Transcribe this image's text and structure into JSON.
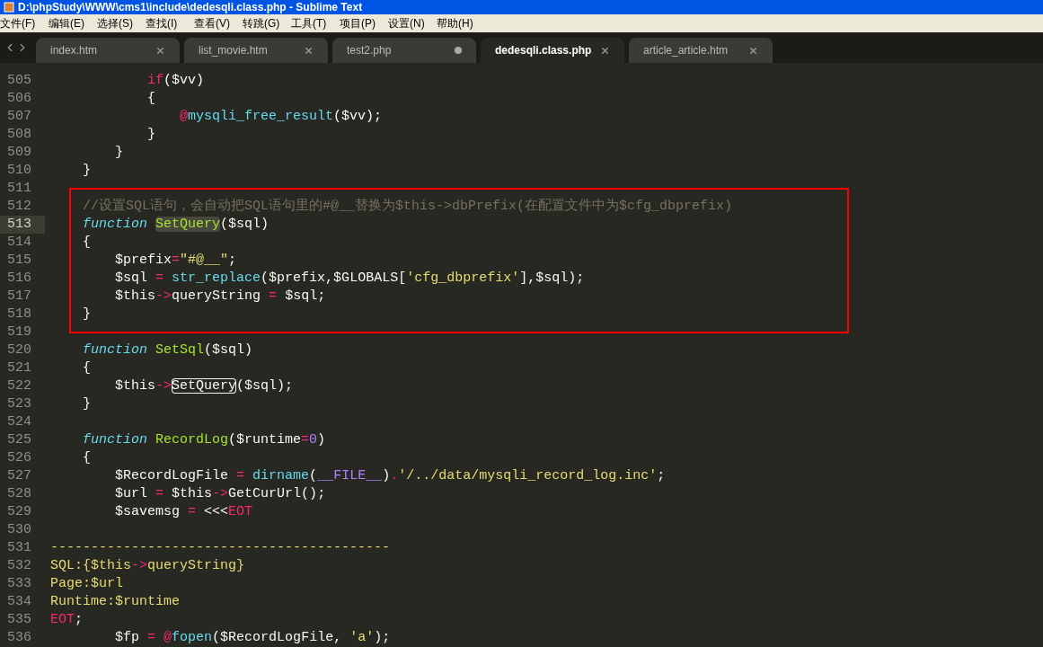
{
  "window": {
    "title": "D:\\phpStudy\\WWW\\cms1\\include\\dedesqli.class.php - Sublime Text"
  },
  "menu": [
    "文件(F)",
    "编辑(E)",
    "选择(S)",
    "查找(I)",
    "查看(V)",
    "转跳(G)",
    "工具(T)",
    "项目(P)",
    "设置(N)",
    "帮助(H)"
  ],
  "tabs": [
    {
      "label": "index.htm",
      "selected": false,
      "modified": false
    },
    {
      "label": "list_movie.htm",
      "selected": false,
      "modified": false
    },
    {
      "label": "test2.php",
      "selected": false,
      "modified": true
    },
    {
      "label": "dedesqli.class.php",
      "selected": true,
      "modified": false
    },
    {
      "label": "article_article.htm",
      "selected": false,
      "modified": false
    }
  ],
  "editor": {
    "lines": [
      {
        "number": "505",
        "current": false,
        "boxed": false,
        "tokens": [
          {
            "text": "            if",
            "kind": "keyword"
          },
          {
            "text": "($vv)",
            "kind": "plain"
          }
        ]
      },
      {
        "number": "506",
        "current": false,
        "boxed": false,
        "tokens": [
          {
            "text": "            {",
            "kind": "plain"
          }
        ]
      },
      {
        "number": "507",
        "current": false,
        "boxed": false,
        "tokens": [
          {
            "text": "                @",
            "kind": "keyword"
          },
          {
            "text": "mysqli_free_result",
            "kind": "builtin"
          },
          {
            "text": "($vv);",
            "kind": "plain"
          }
        ]
      },
      {
        "number": "508",
        "current": false,
        "boxed": false,
        "tokens": [
          {
            "text": "            }",
            "kind": "plain"
          }
        ]
      },
      {
        "number": "509",
        "current": false,
        "boxed": false,
        "tokens": [
          {
            "text": "        }",
            "kind": "plain"
          }
        ]
      },
      {
        "number": "510",
        "current": false,
        "boxed": false,
        "tokens": [
          {
            "text": "    }",
            "kind": "plain"
          }
        ]
      },
      {
        "number": "511",
        "current": false,
        "boxed": false
      },
      {
        "number": "512",
        "current": false,
        "boxed": true,
        "tokens": [
          {
            "text": "    //设置SQL语句，会自动把SQL语句里的#@__替换为$this->dbPrefix(在配置文件中为$cfg_dbprefix)",
            "kind": "comment"
          }
        ]
      },
      {
        "number": "513",
        "current": true,
        "boxed": true,
        "tokens": [
          {
            "text": "    function",
            "kind": "storage"
          },
          {
            "text": " SetQuery",
            "kind": "entity",
            "highlighted": true
          },
          {
            "text": "($sql)",
            "kind": "plain"
          }
        ]
      },
      {
        "number": "514",
        "current": false,
        "boxed": true,
        "tokens": [
          {
            "text": "    {",
            "kind": "plain"
          }
        ]
      },
      {
        "number": "515",
        "current": false,
        "boxed": true,
        "tokens": [
          {
            "text": "        $prefix",
            "kind": "plain"
          },
          {
            "text": "=",
            "kind": "keyword"
          },
          {
            "text": "\"#@__\"",
            "kind": "string"
          },
          {
            "text": ";",
            "kind": "plain"
          }
        ]
      },
      {
        "number": "516",
        "current": false,
        "boxed": true,
        "tokens": [
          {
            "text": "        $sql",
            "kind": "plain"
          },
          {
            "text": " =",
            "kind": "keyword"
          },
          {
            "text": " str_replace",
            "kind": "builtin"
          },
          {
            "text": "($prefix,$GLOBALS[",
            "kind": "plain"
          },
          {
            "text": "'cfg_dbprefix'",
            "kind": "string"
          },
          {
            "text": "],$sql);",
            "kind": "plain"
          }
        ]
      },
      {
        "number": "517",
        "current": false,
        "boxed": true,
        "tokens": [
          {
            "text": "        $this",
            "kind": "plain"
          },
          {
            "text": "->",
            "kind": "keyword"
          },
          {
            "text": "queryString",
            "kind": "plain"
          },
          {
            "text": " =",
            "kind": "keyword"
          },
          {
            "text": " $sql;",
            "kind": "plain"
          }
        ]
      },
      {
        "number": "518",
        "current": false,
        "boxed": true,
        "tokens": [
          {
            "text": "    }",
            "kind": "plain"
          }
        ]
      },
      {
        "number": "519",
        "current": false,
        "boxed": false
      },
      {
        "number": "520",
        "current": false,
        "boxed": false,
        "tokens": [
          {
            "text": "    function",
            "kind": "storage"
          },
          {
            "text": " SetSql",
            "kind": "entity"
          },
          {
            "text": "($sql)",
            "kind": "plain"
          }
        ]
      },
      {
        "number": "521",
        "current": false,
        "boxed": false,
        "tokens": [
          {
            "text": "    {",
            "kind": "plain"
          }
        ]
      },
      {
        "number": "522",
        "current": false,
        "boxed": false,
        "tokens": [
          {
            "text": "        $this",
            "kind": "plain"
          },
          {
            "text": "->",
            "kind": "keyword"
          },
          {
            "text": "SetQuery",
            "kind": "plain",
            "outlined": true
          },
          {
            "text": "($sql);",
            "kind": "plain"
          }
        ]
      },
      {
        "number": "523",
        "current": false,
        "boxed": false,
        "tokens": [
          {
            "text": "    }",
            "kind": "plain"
          }
        ]
      },
      {
        "number": "524",
        "current": false,
        "boxed": false
      },
      {
        "number": "525",
        "current": false,
        "boxed": false,
        "tokens": [
          {
            "text": "    function",
            "kind": "storage"
          },
          {
            "text": " RecordLog",
            "kind": "entity"
          },
          {
            "text": "($runtime",
            "kind": "plain"
          },
          {
            "text": "=",
            "kind": "keyword"
          },
          {
            "text": "0",
            "kind": "constant"
          },
          {
            "text": ")",
            "kind": "plain"
          }
        ]
      },
      {
        "number": "526",
        "current": false,
        "boxed": false,
        "tokens": [
          {
            "text": "    {",
            "kind": "plain"
          }
        ]
      },
      {
        "number": "527",
        "current": false,
        "boxed": false,
        "tokens": [
          {
            "text": "        $RecordLogFile",
            "kind": "plain"
          },
          {
            "text": " =",
            "kind": "keyword"
          },
          {
            "text": " dirname",
            "kind": "builtin"
          },
          {
            "text": "(",
            "kind": "plain"
          },
          {
            "text": "__FILE__",
            "kind": "constant"
          },
          {
            "text": ")",
            "kind": "plain"
          },
          {
            "text": ".",
            "kind": "keyword"
          },
          {
            "text": "'/../data/mysqli_record_log.inc'",
            "kind": "string"
          },
          {
            "text": ";",
            "kind": "plain"
          }
        ]
      },
      {
        "number": "528",
        "current": false,
        "boxed": false,
        "tokens": [
          {
            "text": "        $url",
            "kind": "plain"
          },
          {
            "text": " =",
            "kind": "keyword"
          },
          {
            "text": " $this",
            "kind": "plain"
          },
          {
            "text": "->",
            "kind": "keyword"
          },
          {
            "text": "GetCurUrl();",
            "kind": "plain"
          }
        ]
      },
      {
        "number": "529",
        "current": false,
        "boxed": false,
        "tokens": [
          {
            "text": "        $savemsg",
            "kind": "plain"
          },
          {
            "text": " =",
            "kind": "keyword"
          },
          {
            "text": " <<<",
            "kind": "plain"
          },
          {
            "text": "EOT",
            "kind": "keyword"
          }
        ]
      },
      {
        "number": "530",
        "current": false,
        "boxed": false
      },
      {
        "number": "531",
        "current": false,
        "boxed": false,
        "tokens": [
          {
            "text": "------------------------------------------",
            "kind": "string"
          }
        ]
      },
      {
        "number": "532",
        "current": false,
        "boxed": false,
        "tokens": [
          {
            "text": "SQL:{$this",
            "kind": "string"
          },
          {
            "text": "->",
            "kind": "keyword"
          },
          {
            "text": "queryString}",
            "kind": "string"
          }
        ]
      },
      {
        "number": "533",
        "current": false,
        "boxed": false,
        "tokens": [
          {
            "text": "Page:$url",
            "kind": "string"
          }
        ]
      },
      {
        "number": "534",
        "current": false,
        "boxed": false,
        "tokens": [
          {
            "text": "Runtime:$runtime",
            "kind": "string"
          }
        ]
      },
      {
        "number": "535",
        "current": false,
        "boxed": false,
        "tokens": [
          {
            "text": "EOT",
            "kind": "keyword"
          },
          {
            "text": ";",
            "kind": "plain"
          }
        ]
      },
      {
        "number": "536",
        "current": false,
        "boxed": false,
        "tokens": [
          {
            "text": "        $fp",
            "kind": "plain"
          },
          {
            "text": " =",
            "kind": "keyword"
          },
          {
            "text": " @",
            "kind": "keyword"
          },
          {
            "text": "fopen",
            "kind": "builtin"
          },
          {
            "text": "($RecordLogFile, ",
            "kind": "plain"
          },
          {
            "text": "'a'",
            "kind": "string"
          },
          {
            "text": ");",
            "kind": "plain"
          }
        ]
      }
    ]
  }
}
